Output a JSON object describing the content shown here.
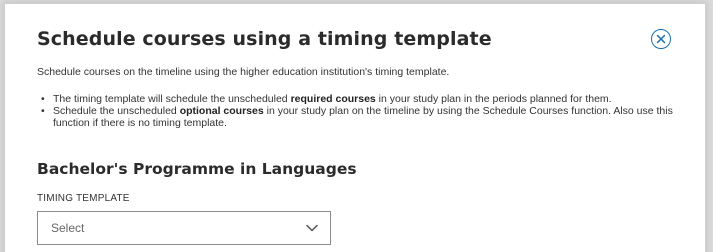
{
  "dialog": {
    "title": "Schedule courses using a timing template",
    "intro": "Schedule courses on the timeline using the higher education institution's timing template.",
    "bullets": [
      {
        "bullet": "•",
        "before": "The timing template will schedule the unscheduled ",
        "bold": "required courses",
        "after": " in your study plan in the periods planned for them."
      },
      {
        "bullet": "•",
        "before": "Schedule the unscheduled ",
        "bold": "optional courses",
        "after": " in your study plan on the timeline by using the Schedule Courses function. Also use this function if there is no timing template."
      }
    ],
    "close_icon": "close-circle-icon"
  },
  "programme": {
    "title": "Bachelor's Programme in Languages"
  },
  "timing_template": {
    "label": "TIMING TEMPLATE",
    "selected": "Select",
    "icon": "chevron-down-icon"
  },
  "colors": {
    "accent": "#1a6fb0",
    "text": "#2b2b2b",
    "border": "#8c8c8c"
  }
}
